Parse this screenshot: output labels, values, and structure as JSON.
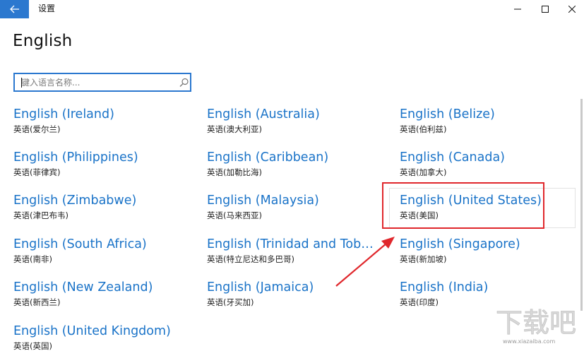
{
  "window": {
    "title": "设置",
    "back_icon": "arrow-left-icon",
    "controls": [
      "minimize-icon",
      "maximize-icon",
      "close-icon"
    ],
    "accent_color": "#2b78cf"
  },
  "page": {
    "title": "English"
  },
  "search": {
    "placeholder": "键入语言名称...",
    "value": "",
    "icon": "search-icon"
  },
  "languages": [
    {
      "name": "English (Ireland)",
      "native": "英语(爱尔兰)"
    },
    {
      "name": "English (Australia)",
      "native": "英语(澳大利亚)"
    },
    {
      "name": "English (Belize)",
      "native": "英语(伯利兹)"
    },
    {
      "name": "English (Philippines)",
      "native": "英语(菲律宾)"
    },
    {
      "name": "English (Caribbean)",
      "native": "英语(加勒比海)"
    },
    {
      "name": "English (Canada)",
      "native": "英语(加拿大)"
    },
    {
      "name": "English (Zimbabwe)",
      "native": "英语(津巴布韦)"
    },
    {
      "name": "English (Malaysia)",
      "native": "英语(马来西亚)"
    },
    {
      "name": "English (United States)",
      "native": "英语(美国)"
    },
    {
      "name": "English (South Africa)",
      "native": "英语(南非)"
    },
    {
      "name": "English (Trinidad and Toba...",
      "native": "英语(特立尼达和多巴哥)"
    },
    {
      "name": "English (Singapore)",
      "native": "英语(新加坡)"
    },
    {
      "name": "English (New Zealand)",
      "native": "英语(新西兰)"
    },
    {
      "name": "English (Jamaica)",
      "native": "英语(牙买加)"
    },
    {
      "name": "English (India)",
      "native": "英语(印度)"
    },
    {
      "name": "English (United Kingdom)",
      "native": "英语(英国)"
    }
  ],
  "highlight": {
    "selected": "English (United States)",
    "frame_color": "#e0272c"
  },
  "watermark": {
    "text": "下载吧",
    "url_text": "www.xiazaiba.com"
  }
}
